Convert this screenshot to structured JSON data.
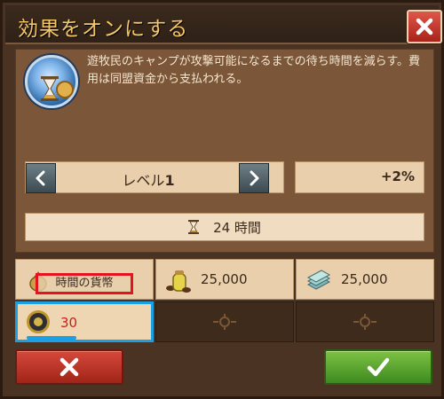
{
  "dialog": {
    "title": "効果をオンにする",
    "description": "遊牧民のキャンプが攻撃可能になるまでの待ち時間を減らす。費用は同盟資金から支払われる。"
  },
  "level": {
    "label": "レベル",
    "value": "1",
    "bonus": "+2%"
  },
  "duration": {
    "text": "24 時間"
  },
  "costs": [
    {
      "icon": "coin-bag-icon",
      "label": "時間の貨幣"
    },
    {
      "icon": "oil-jar-icon",
      "value": "25,000"
    },
    {
      "icon": "cloth-stack-icon",
      "value": "25,000"
    }
  ],
  "items": [
    {
      "icon": "alliance-token-icon",
      "count": "30",
      "selected": true
    },
    {
      "icon": "empty-slot-icon"
    },
    {
      "icon": "empty-slot-icon"
    }
  ],
  "colors": {
    "title": "#f3c66a",
    "highlight": "#e6121e",
    "selected_border": "#1aa0e3",
    "cancel": "#c0392b",
    "confirm": "#5aa832"
  }
}
